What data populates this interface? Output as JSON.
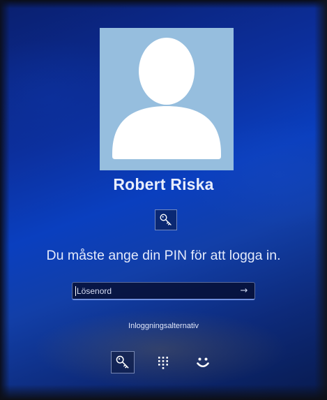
{
  "user": {
    "name": "Robert Riska"
  },
  "sign_in": {
    "message": "Du måste ange din PIN för att logga in.",
    "password_placeholder": "Lösenord",
    "submit_glyph": "→",
    "options_label": "Inloggningsalternativ"
  },
  "sign_in_options": [
    {
      "name": "password",
      "icon": "key-icon",
      "selected": true
    },
    {
      "name": "pin",
      "icon": "keypad-icon",
      "selected": false
    },
    {
      "name": "face",
      "icon": "smiley-face-icon",
      "selected": false
    }
  ],
  "colors": {
    "avatar_background": "#96bede",
    "text": "#e9eefc"
  }
}
